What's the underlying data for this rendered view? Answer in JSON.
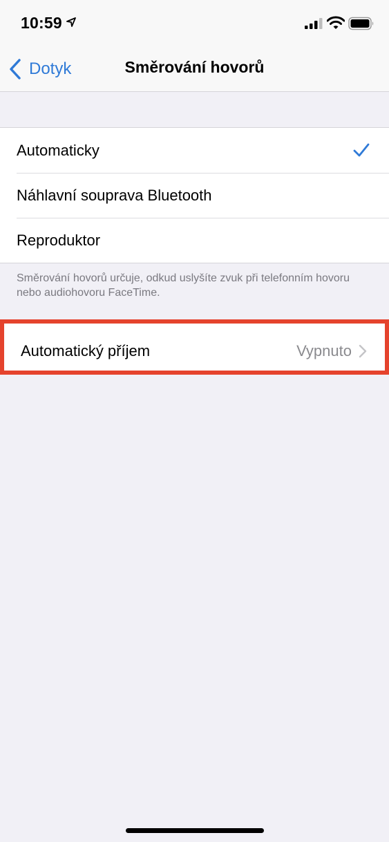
{
  "status_bar": {
    "time": "10:59"
  },
  "nav": {
    "back_label": "Dotyk",
    "title": "Směrování hovorů"
  },
  "routing_options": [
    {
      "label": "Automaticky",
      "selected": true
    },
    {
      "label": "Náhlavní souprava Bluetooth",
      "selected": false
    },
    {
      "label": "Reproduktor",
      "selected": false
    }
  ],
  "footer_note": "Směrování hovorů určuje, odkud uslyšíte zvuk při telefonním hovoru nebo audiohovoru FaceTime.",
  "auto_answer": {
    "label": "Automatický příjem",
    "value": "Vypnuto"
  },
  "colors": {
    "accent": "#2f7ad7",
    "highlight": "#e5432d",
    "background": "#f1f0f6"
  },
  "icons": [
    "location-arrow-icon",
    "cellular-signal-icon",
    "wifi-icon",
    "battery-icon",
    "chevron-left-icon",
    "checkmark-icon",
    "chevron-right-icon"
  ]
}
